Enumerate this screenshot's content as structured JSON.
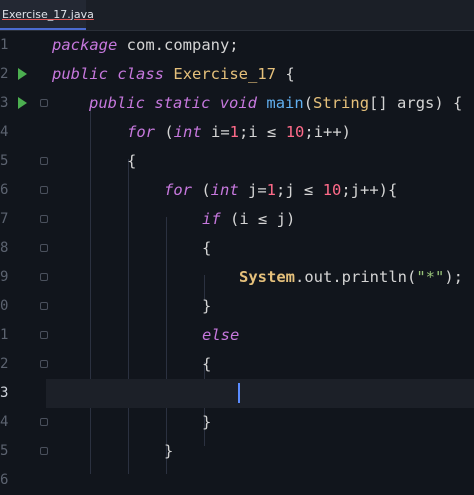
{
  "tab": {
    "label": "Exercise_17.java"
  },
  "gutter": {
    "line_numbers": [
      "1",
      "2",
      "3",
      "4",
      "5",
      "6",
      "7",
      "8",
      "9",
      "0",
      "1",
      "2",
      "3",
      "4",
      "5",
      "6"
    ]
  },
  "code": {
    "l1": {
      "kw": "package",
      "rest": " com.company;"
    },
    "l2": {
      "kw1": "public",
      "kw2": "class",
      "name": "Exercise_17",
      "rest": " {"
    },
    "l3": {
      "kw1": "public",
      "kw2": "static",
      "kw3": "void",
      "fn": "main",
      "p1": "(",
      "type": "String",
      "p2": "[] args) {"
    },
    "l4": {
      "kw": "for",
      "p1": " (",
      "kw2": "int",
      "p2": " i=",
      "n1": "1",
      "p3": ";i ≤ ",
      "n2": "10",
      "p4": ";i++)"
    },
    "l5": {
      "text": "{"
    },
    "l6": {
      "kw": "for",
      "p1": " (",
      "kw2": "int",
      "p2": " j=",
      "n1": "1",
      "p3": ";j ≤ ",
      "n2": "10",
      "p4": ";j++){"
    },
    "l7": {
      "kw": "if",
      "p1": " (i ≤ j)"
    },
    "l8": {
      "text": "{"
    },
    "l9": {
      "cls": "System",
      "p1": ".out.",
      "fn": "println",
      "p2": "(",
      "str": "\"*\"",
      "p3": ");"
    },
    "l10": {
      "text": "}"
    },
    "l11": {
      "kw": "else"
    },
    "l12": {
      "text": "{"
    },
    "l13": {
      "text": ""
    },
    "l14": {
      "text": "}"
    },
    "l15": {
      "text": "}"
    }
  }
}
